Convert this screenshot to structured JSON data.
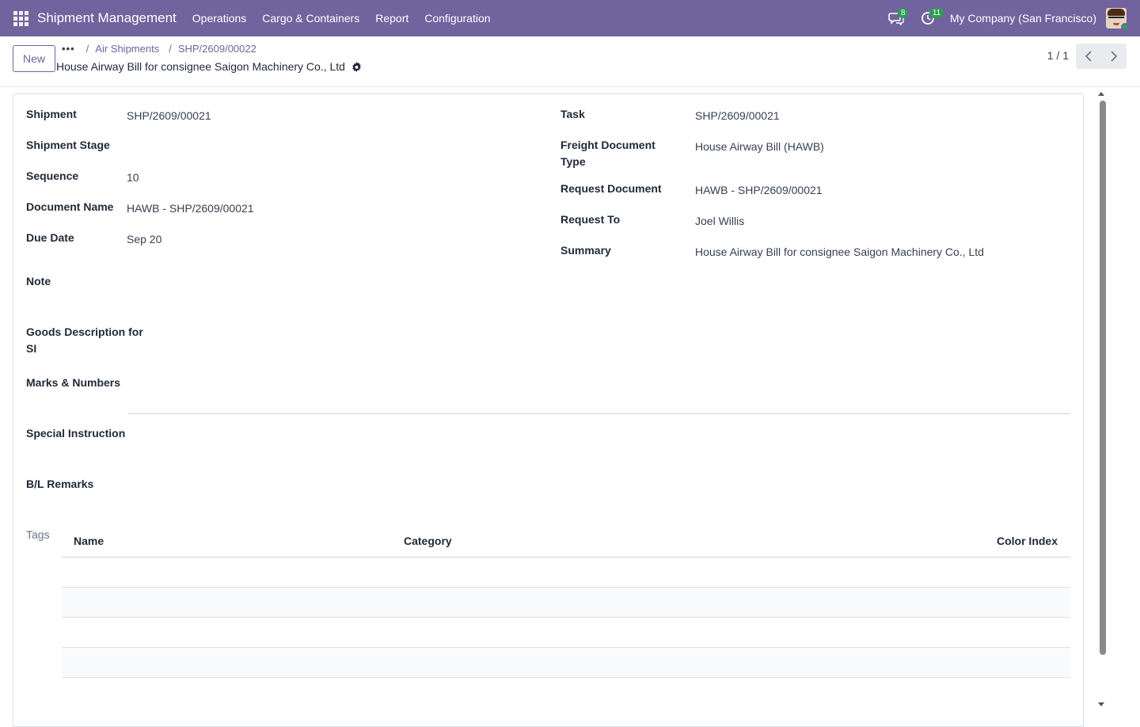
{
  "navbar": {
    "app_title": "Shipment Management",
    "menus": [
      {
        "label": "Operations"
      },
      {
        "label": "Cargo & Containers"
      },
      {
        "label": "Report"
      },
      {
        "label": "Configuration"
      }
    ],
    "messages_badge": "8",
    "activities_badge": "11",
    "company": "My Company (San Francisco)",
    "accent_color": "#71639e"
  },
  "control_panel": {
    "new_label": "New",
    "breadcrumb_dots": "•••",
    "breadcrumb": [
      {
        "label": "Air Shipments"
      },
      {
        "label": "SHP/2609/00022"
      }
    ],
    "record_title": "House Airway Bill for consignee Saigon Machinery Co., Ltd",
    "pager": "1 / 1"
  },
  "form": {
    "left": [
      {
        "label": "Shipment",
        "value": "SHP/2609/00021"
      },
      {
        "label": "Shipment Stage",
        "value": ""
      },
      {
        "label": "Sequence",
        "value": "10"
      },
      {
        "label": "Document Name",
        "value": "HAWB - SHP/2609/00021"
      },
      {
        "label": "Due Date",
        "value": "Sep 20"
      }
    ],
    "right": [
      {
        "label": "Task",
        "value": "SHP/2609/00021"
      },
      {
        "label": "Freight Document",
        "label2": "Type",
        "value": "House Airway Bill (HAWB)"
      },
      {
        "label": "Request Document",
        "value": "HAWB - SHP/2609/00021"
      },
      {
        "label": "Request To",
        "value": "Joel Willis"
      },
      {
        "label": "Summary",
        "value": "House Airway Bill for consignee Saigon Machinery Co., Ltd"
      }
    ],
    "note_label": "Note",
    "goods_label_1": "Goods Description for",
    "goods_label_2": "SI",
    "marks_label": "Marks & Numbers",
    "special_label": "Special Instruction",
    "bl_label": "B/L Remarks",
    "tags": {
      "label": "Tags",
      "columns": [
        "Name",
        "Category",
        "Color Index"
      ]
    }
  }
}
